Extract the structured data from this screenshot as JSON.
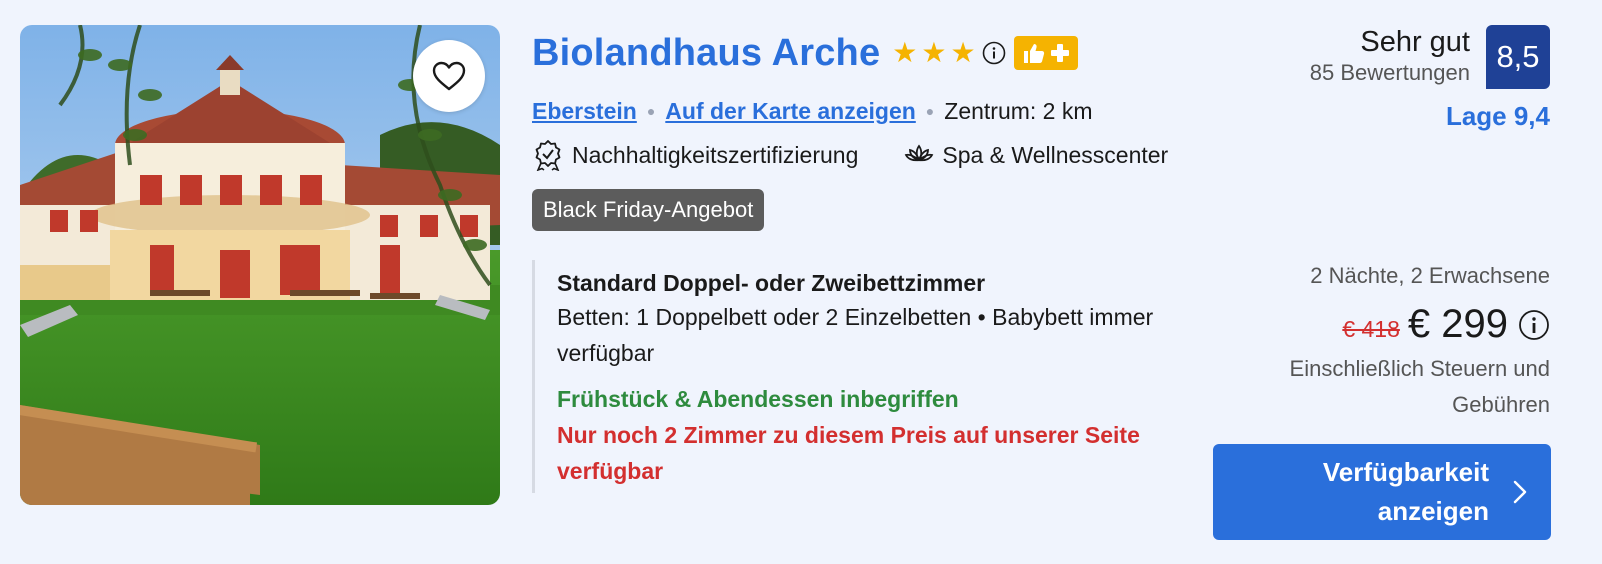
{
  "hotel": {
    "name": "Biolandhaus Arche",
    "stars": 3,
    "location": {
      "city": "Eberstein",
      "map_link": "Auf der Karte anzeigen",
      "distance": "Zentrum: 2 km"
    },
    "amenities": [
      {
        "icon": "certificate-icon",
        "label": "Nachhaltigkeitszertifizierung"
      },
      {
        "icon": "spa-icon",
        "label": "Spa & Wellnesscenter"
      }
    ],
    "deal_badge": "Black Friday-Angebot"
  },
  "rating": {
    "label": "Sehr gut",
    "reviews": "85 Bewertungen",
    "score": "8,5",
    "location_score": "Lage 9,4"
  },
  "room": {
    "title": "Standard Doppel- oder Zweibettzimmer",
    "beds": "Betten: 1 Doppelbett oder 2 Einzelbetten • Babybett immer verfügbar",
    "meals": "Frühstück & Abendessen inbegriffen",
    "availability": "Nur noch 2 Zimmer zu diesem Preis auf unserer Seite verfügbar"
  },
  "price": {
    "stay": "2 Nächte, 2 Erwachsene",
    "original": "€ 418",
    "current": "€ 299",
    "taxes": "Einschließlich Steuern und Gebühren"
  },
  "cta": {
    "label": "Verfügbarkeit anzeigen"
  },
  "colors": {
    "link_blue": "#2a6fdb",
    "score_bg": "#1f4196",
    "star": "#f5b301",
    "green": "#2e8b3e",
    "red": "#d32f2f"
  }
}
